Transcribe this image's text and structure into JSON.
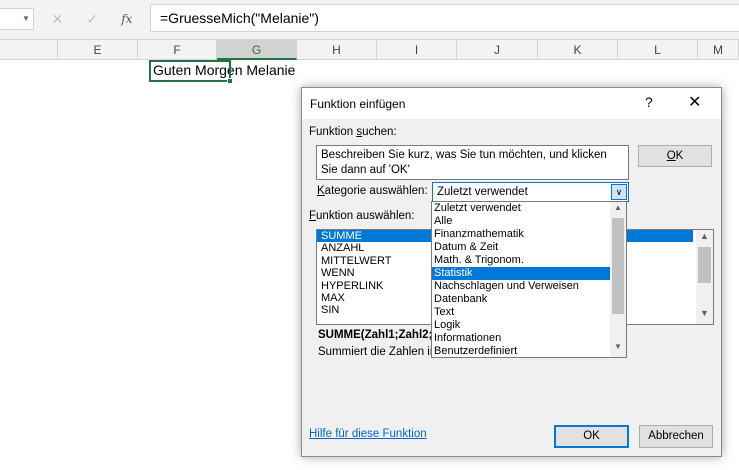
{
  "formula_bar": {
    "cancel_icon": "✕",
    "enter_icon": "✓",
    "fx_label": "fx",
    "formula": "=GruesseMich(\"Melanie\")"
  },
  "columns": [
    "E",
    "F",
    "G",
    "H",
    "I",
    "J",
    "K",
    "L",
    "M"
  ],
  "selected_column": "G",
  "cell_value": "Guten Morgen Melanie",
  "dialog": {
    "title": "Funktion einfügen",
    "help_glyph": "?",
    "close_glyph": "✕",
    "search_label_pre": "Funktion ",
    "search_label_u": "s",
    "search_label_post": "uchen:",
    "search_text": "Beschreiben Sie kurz, was Sie tun möchten, und klicken Sie dann auf 'OK'",
    "search_ok_u": "O",
    "search_ok_post": "K",
    "category_label_u": "K",
    "category_label_post": "ategorie auswählen:",
    "category_value": "Zuletzt verwendet",
    "function_label_u": "F",
    "function_label_post": "unktion auswählen:",
    "functions": [
      "SUMME",
      "ANZAHL",
      "MITTELWERT",
      "WENN",
      "HYPERLINK",
      "MAX",
      "SIN"
    ],
    "selected_function": "SUMME",
    "syntax": "SUMME(Zahl1;Zahl2;...)",
    "description": "Summiert die Zahlen in einem Zellbereich.",
    "help_link": "Hilfe für diese Funktion",
    "ok_label": "OK",
    "cancel_label": "Abbrechen"
  },
  "category_options": [
    "Zuletzt verwendet",
    "Alle",
    "Finanzmathematik",
    "Datum & Zeit",
    "Math. & Trigonom.",
    "Statistik",
    "Nachschlagen und Verweisen",
    "Datenbank",
    "Text",
    "Logik",
    "Informationen",
    "Benutzerdefiniert"
  ],
  "highlighted_category": "Statistik"
}
